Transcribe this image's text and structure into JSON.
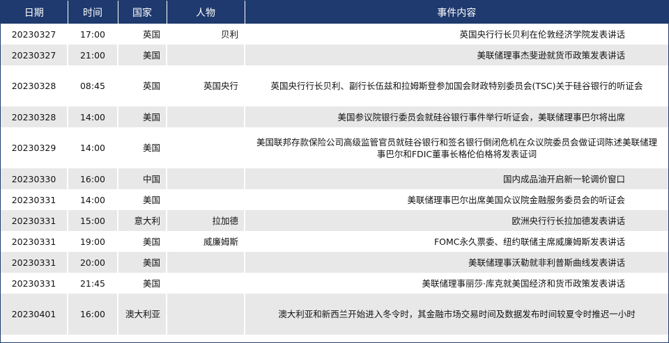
{
  "headers": {
    "date": "日期",
    "time": "时间",
    "country": "国家",
    "person": "人物",
    "event": "事件内容"
  },
  "rows": [
    {
      "date": "20230327",
      "time": "17:00",
      "country": "英国",
      "person": "贝利",
      "event": "英国央行行长贝利在伦敦经济学院发表讲话"
    },
    {
      "date": "20230327",
      "time": "21:00",
      "country": "美国",
      "person": "",
      "event": "美联储理事杰斐逊就货币政策发表讲话"
    },
    {
      "date": "20230328",
      "time": "08:45",
      "country": "英国",
      "person": "英国央行",
      "event": "英国央行行长贝利、副行长伍兹和拉姆斯登参加国会财政特别委员会(TSC)关于硅谷银行的听证会"
    },
    {
      "date": "20230328",
      "time": "14:00",
      "country": "美国",
      "person": "",
      "event": "美国参议院银行委员会就硅谷银行事件举行听证会，美联储理事巴尔将出席"
    },
    {
      "date": "20230329",
      "time": "14:00",
      "country": "美国",
      "person": "",
      "event": "美国联邦存款保险公司高级监管官员就硅谷银行和签名银行倒闭危机在众议院委员会做证词陈述美联储理事巴尔和FDIC董事长格伦伯格将发表证词"
    },
    {
      "date": "20230330",
      "time": "16:00",
      "country": "中国",
      "person": "",
      "event": "国内成品油开启新一轮调价窗口"
    },
    {
      "date": "20230331",
      "time": "14:00",
      "country": "美国",
      "person": "",
      "event": "美联储理事巴尔出席美国众议院金融服务委员会的听证会"
    },
    {
      "date": "20230331",
      "time": "15:00",
      "country": "意大利",
      "person": "拉加德",
      "event": "欧洲央行行长拉加德发表讲话"
    },
    {
      "date": "20230331",
      "time": "19:00",
      "country": "美国",
      "person": "威廉姆斯",
      "event": "FOMC永久票委、纽约联储主席威廉姆斯发表讲话"
    },
    {
      "date": "20230331",
      "time": "20:00",
      "country": "美国",
      "person": "",
      "event": "美联储理事沃勒就非利普斯曲线发表讲话"
    },
    {
      "date": "20230331",
      "time": "21:45",
      "country": "美国",
      "person": "",
      "event": "美联储理事丽莎·库克就美国经济和货币政策发表讲话"
    },
    {
      "date": "20230401",
      "time": "16:00",
      "country": "澳大利亚",
      "person": "",
      "event": "澳大利亚和新西兰开始进入冬令时，其金融市场交易时间及数据发布时间较夏令时推迟一小时"
    }
  ]
}
